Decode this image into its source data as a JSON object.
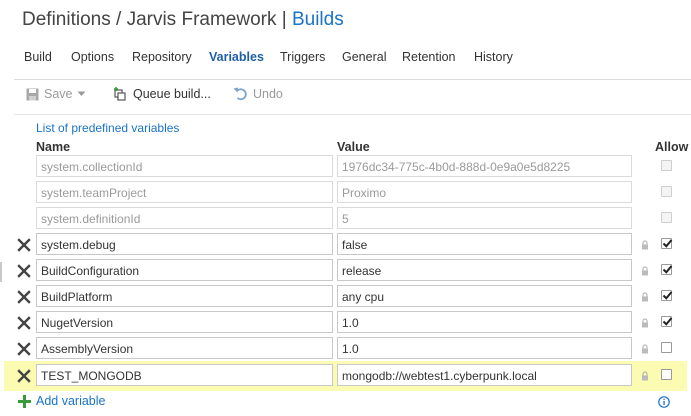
{
  "header": {
    "prefix": "Definitions",
    "separator": "/",
    "project": "Jarvis Framework",
    "divider": "|",
    "section": "Builds"
  },
  "tabs": [
    {
      "label": "Build",
      "active": false
    },
    {
      "label": "Options",
      "active": false
    },
    {
      "label": "Repository",
      "active": false
    },
    {
      "label": "Variables",
      "active": true
    },
    {
      "label": "Triggers",
      "active": false
    },
    {
      "label": "General",
      "active": false
    },
    {
      "label": "Retention",
      "active": false
    },
    {
      "label": "History",
      "active": false
    }
  ],
  "toolbar": {
    "save_label": "Save",
    "queue_label": "Queue build...",
    "undo_label": "Undo"
  },
  "predefined_link": "List of predefined variables",
  "columns": {
    "name": "Name",
    "value": "Value",
    "allow": "Allow"
  },
  "rows": [
    {
      "name": "system.collectionId",
      "value": "1976dc34-775c-4b0d-888d-0e9a0e5d8225",
      "readonly": true,
      "allow": false
    },
    {
      "name": "system.teamProject",
      "value": "Proximo",
      "readonly": true,
      "allow": false
    },
    {
      "name": "system.definitionId",
      "value": "5",
      "readonly": true,
      "allow": false
    },
    {
      "name": "system.debug",
      "value": "false",
      "readonly": false,
      "allow": true
    },
    {
      "name": "BuildConfiguration",
      "value": "release",
      "readonly": false,
      "allow": true
    },
    {
      "name": "BuildPlatform",
      "value": "any cpu",
      "readonly": false,
      "allow": true
    },
    {
      "name": "NugetVersion",
      "value": "1.0",
      "readonly": false,
      "allow": true
    },
    {
      "name": "AssemblyVersion",
      "value": "1.0",
      "readonly": false,
      "allow": false
    },
    {
      "name": "TEST_MONGODB",
      "value": "mongodb://webtest1.cyberpunk.local",
      "readonly": false,
      "allow": false,
      "highlighted": true
    }
  ],
  "add_variable": "Add variable",
  "colors": {
    "link": "#1a73c8",
    "highlight": "#fbfbb2",
    "active_tab": "#1f5fa6"
  }
}
